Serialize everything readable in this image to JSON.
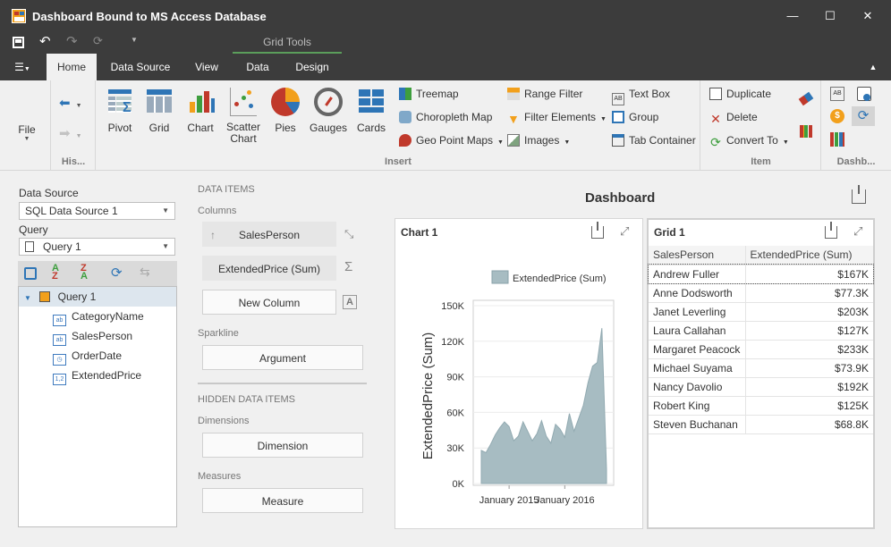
{
  "window": {
    "title": "Dashboard Bound to MS Access Database",
    "minimize": "—",
    "maximize": "☐",
    "close": "✕"
  },
  "qat": {
    "context_label": "Grid Tools"
  },
  "tabs": [
    {
      "label": "Home"
    },
    {
      "label": "Data Source"
    },
    {
      "label": "View"
    },
    {
      "label": "Data"
    },
    {
      "label": "Design"
    }
  ],
  "ribbon": {
    "file_label": "File",
    "history_label": "His...",
    "insert_label": "Insert",
    "item_label": "Item",
    "dashboard_label": "Dashb...",
    "big_buttons": [
      {
        "label": "Pivot"
      },
      {
        "label": "Grid"
      },
      {
        "label": "Chart"
      },
      {
        "label": "Scatter Chart"
      },
      {
        "label": "Pies"
      },
      {
        "label": "Gauges"
      },
      {
        "label": "Cards"
      }
    ],
    "insert_small": [
      {
        "label": "Treemap"
      },
      {
        "label": "Choropleth Map"
      },
      {
        "label": "Geo Point Maps"
      },
      {
        "label": "Range Filter"
      },
      {
        "label": "Filter Elements"
      },
      {
        "label": "Images"
      },
      {
        "label": "Text Box"
      },
      {
        "label": "Group"
      },
      {
        "label": "Tab Container"
      }
    ],
    "item_small": [
      {
        "label": "Duplicate"
      },
      {
        "label": "Delete"
      },
      {
        "label": "Convert To"
      }
    ]
  },
  "left": {
    "datasource_label": "Data Source",
    "datasource_value": "SQL Data Source 1",
    "query_label": "Query",
    "query_value": "Query 1",
    "tree": {
      "root": "Query 1",
      "fields": [
        {
          "name": "CategoryName",
          "type": "ab"
        },
        {
          "name": "SalesPerson",
          "type": "ab"
        },
        {
          "name": "OrderDate",
          "type": "◷"
        },
        {
          "name": "ExtendedPrice",
          "type": "1,2"
        }
      ]
    }
  },
  "data_items": {
    "title": "DATA ITEMS",
    "columns_label": "Columns",
    "columns": [
      "SalesPerson",
      "ExtendedPrice (Sum)",
      "New Column"
    ],
    "sparkline_label": "Sparkline",
    "argument": "Argument",
    "hidden_title": "HIDDEN DATA ITEMS",
    "dimensions_label": "Dimensions",
    "dimension": "Dimension",
    "measures_label": "Measures",
    "measure": "Measure"
  },
  "dashboard": {
    "title": "Dashboard"
  },
  "chart": {
    "title": "Chart 1"
  },
  "chart_data": {
    "type": "area",
    "title": "",
    "series": [
      {
        "name": "ExtendedPrice (Sum)",
        "values": [
          28,
          26,
          33,
          41,
          47,
          52,
          48,
          36,
          40,
          52,
          44,
          36,
          42,
          53,
          40,
          34,
          50,
          46,
          39,
          59,
          44,
          55,
          66,
          85,
          99,
          102,
          131,
          12
        ]
      }
    ],
    "x": [
      "2014-07",
      "2014-08",
      "2014-09",
      "2014-10",
      "2014-11",
      "2014-12",
      "2015-01",
      "2015-02",
      "2015-03",
      "2015-04",
      "2015-05",
      "2015-06",
      "2015-07",
      "2015-08",
      "2015-09",
      "2015-10",
      "2015-11",
      "2015-12",
      "2016-01",
      "2016-02",
      "2016-03",
      "2016-04",
      "2016-05",
      "2016-06",
      "2016-07",
      "2016-08",
      "2016-09",
      "2016-10"
    ],
    "ylabel": "ExtendedPrice (Sum)",
    "yticks": [
      "0K",
      "30K",
      "60K",
      "90K",
      "120K",
      "150K"
    ],
    "xticks": [
      "January 2015",
      "January 2016"
    ],
    "ylim": [
      0,
      150
    ],
    "legend": "top",
    "color": "#a7bcc2"
  },
  "grid": {
    "title": "Grid 1",
    "headers": [
      "SalesPerson",
      "ExtendedPrice (Sum)"
    ],
    "rows": [
      [
        "Andrew Fuller",
        "$167K"
      ],
      [
        "Anne Dodsworth",
        "$77.3K"
      ],
      [
        "Janet Leverling",
        "$203K"
      ],
      [
        "Laura Callahan",
        "$127K"
      ],
      [
        "Margaret Peacock",
        "$233K"
      ],
      [
        "Michael Suyama",
        "$73.9K"
      ],
      [
        "Nancy Davolio",
        "$192K"
      ],
      [
        "Robert King",
        "$125K"
      ],
      [
        "Steven Buchanan",
        "$68.8K"
      ]
    ]
  }
}
